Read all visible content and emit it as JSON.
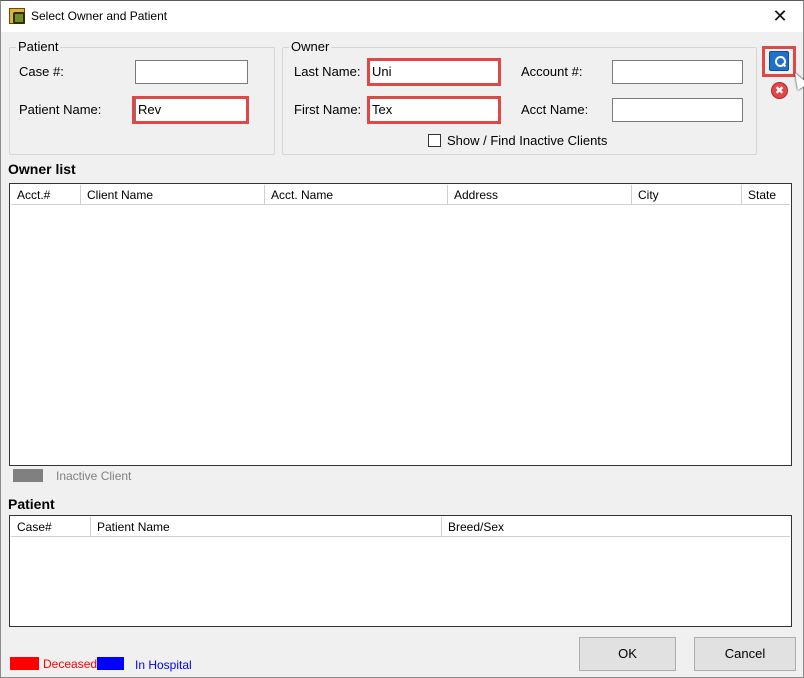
{
  "window": {
    "title": "Select Owner and Patient",
    "close_glyph": "✕"
  },
  "patient_group": {
    "title": "Patient",
    "case_label": "Case #:",
    "case_value": "",
    "name_label": "Patient Name:",
    "name_value": "Rev"
  },
  "owner_group": {
    "title": "Owner",
    "last_name_label": "Last Name:",
    "last_name_value": "Uni",
    "first_name_label": "First Name:",
    "first_name_value": "Tex",
    "account_label": "Account #:",
    "account_value": "",
    "acct_name_label": "Acct Name:",
    "acct_name_value": "",
    "inactive_label": "Show / Find Inactive Clients",
    "inactive_checked": false
  },
  "actions": {
    "search_icon": "search-icon",
    "clear_icon": "clear-icon",
    "clear_glyph": "✖"
  },
  "owner_list": {
    "title": "Owner list",
    "columns": [
      "Acct.#",
      "Client Name",
      "Acct. Name",
      "Address",
      "City",
      "State"
    ],
    "rows": []
  },
  "inactive_legend": {
    "label": "Inactive Client",
    "color": "#808080"
  },
  "patient_list": {
    "title": "Patient",
    "columns": [
      "Case#",
      "Patient Name",
      "Breed/Sex"
    ],
    "rows": []
  },
  "legend": {
    "deceased_label": "Deceased",
    "deceased_color": "#ff0000",
    "hospital_label": "In Hospital",
    "hospital_color": "#0000ff"
  },
  "buttons": {
    "ok": "OK",
    "cancel": "Cancel"
  }
}
